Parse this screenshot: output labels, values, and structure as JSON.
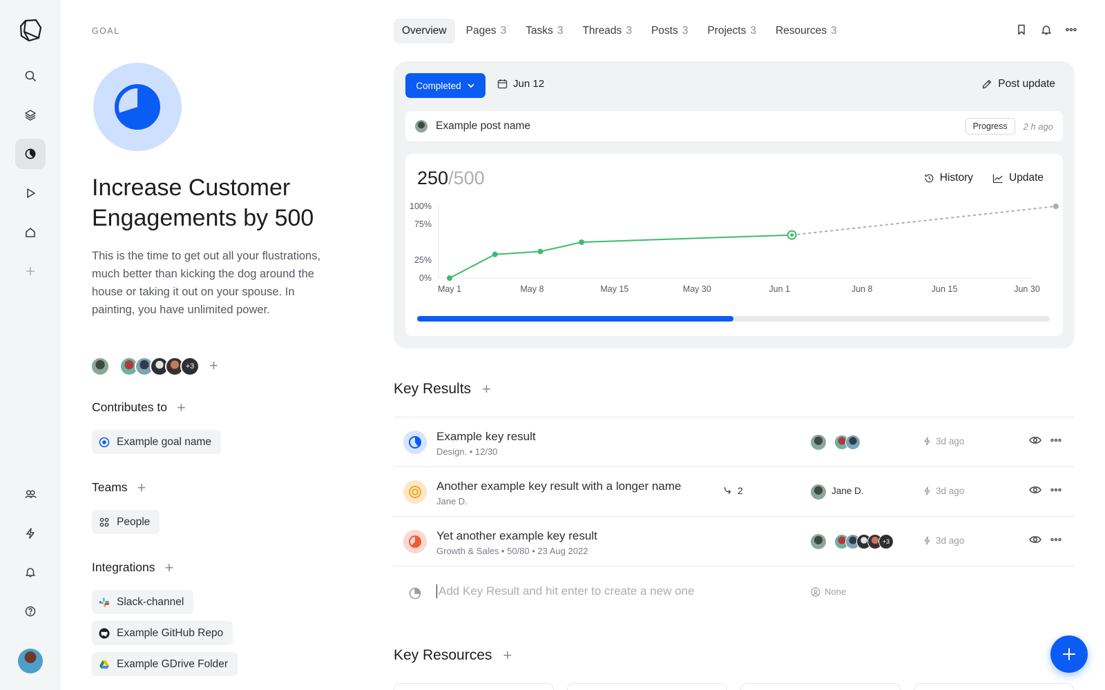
{
  "rail": {
    "items": [
      "logo-icon",
      "search-icon",
      "layers-icon",
      "goals-icon",
      "play-icon",
      "home-icon",
      "plus-icon",
      "users-icon",
      "bolt-icon",
      "bell-icon",
      "help-icon"
    ],
    "active": "goals-icon"
  },
  "goal": {
    "eyebrow": "GOAL",
    "title": "Increase Customer Engagements by 500",
    "description": "This is the time to get out all your flustrations, much better than kicking the dog around the house or taking it out on your spouse. In painting, you have unlimited power.",
    "members_more": "+3",
    "progress_fraction": 0.7
  },
  "contributes": {
    "heading": "Contributes to",
    "items": [
      {
        "label": "Example goal name",
        "icon": "target-icon"
      }
    ]
  },
  "teams": {
    "heading": "Teams",
    "items": [
      {
        "label": "People",
        "icon": "grid-icon"
      }
    ]
  },
  "integrations": {
    "heading": "Integrations",
    "items": [
      {
        "label": "Slack-channel",
        "icon": "slack-icon"
      },
      {
        "label": "Example GitHub Repo",
        "icon": "github-icon"
      },
      {
        "label": "Example GDrive Folder",
        "icon": "gdrive-icon"
      }
    ]
  },
  "tabs": [
    {
      "label": "Overview",
      "count": ""
    },
    {
      "label": "Pages",
      "count": "3"
    },
    {
      "label": "Tasks",
      "count": "3"
    },
    {
      "label": "Threads",
      "count": "3"
    },
    {
      "label": "Posts",
      "count": "3"
    },
    {
      "label": "Projects",
      "count": "3"
    },
    {
      "label": "Resources",
      "count": "3"
    }
  ],
  "status": {
    "label": "Completed",
    "date": "Jun 12",
    "post_update": "Post update",
    "color": "#0a5cf5"
  },
  "latest_post": {
    "name": "Example post name",
    "tag": "Progress",
    "ago": "2 h ago"
  },
  "progress": {
    "current": "250",
    "target": "/500",
    "history": "History",
    "update": "Update",
    "bar_fraction": 0.5
  },
  "chart_data": {
    "type": "line",
    "y_ticks": [
      "100%",
      "75%",
      "25%",
      "0%"
    ],
    "x_ticks": [
      "May 1",
      "May 8",
      "May 15",
      "May 30",
      "Jun 1",
      "Jun 8",
      "Jun 15",
      "Jun 30"
    ],
    "series": [
      {
        "style": "solid",
        "color": "#3dbb6c",
        "points": [
          [
            0,
            0
          ],
          [
            0.55,
            33
          ],
          [
            1.1,
            37
          ],
          [
            1.6,
            50
          ],
          [
            4.15,
            60
          ]
        ]
      },
      {
        "style": "dashed",
        "color": "#a9adb4",
        "points": [
          [
            4.15,
            60
          ],
          [
            7.35,
            100
          ]
        ]
      }
    ]
  },
  "key_results": {
    "heading": "Key Results",
    "items": [
      {
        "title": "Example key result",
        "subtitle": "Design.  •  12/30",
        "owner": "",
        "more": "",
        "subcount": "",
        "updated": "3d ago",
        "color": "#0a5cf5",
        "bg": "#d5e4ff",
        "progress": 0.4
      },
      {
        "title": "Another example key result with a longer name",
        "subtitle": "Jane D.",
        "owner": "Jane D.",
        "more": "",
        "subcount": "2",
        "updated": "3d ago",
        "color": "#f5a623",
        "bg": "#fde7c4",
        "progress": 0
      },
      {
        "title": "Yet another example key result",
        "subtitle": "Growth & Sales  •  50/80  • 23 Aug 2022",
        "owner": "",
        "more": "+3",
        "subcount": "",
        "updated": "3d ago",
        "color": "#f05a38",
        "bg": "#fcd8cf",
        "progress": 0.62
      }
    ],
    "add_placeholder": "Add Key Result and hit enter to create a new one",
    "add_owner": "None"
  },
  "key_resources": {
    "heading": "Key Resources"
  }
}
